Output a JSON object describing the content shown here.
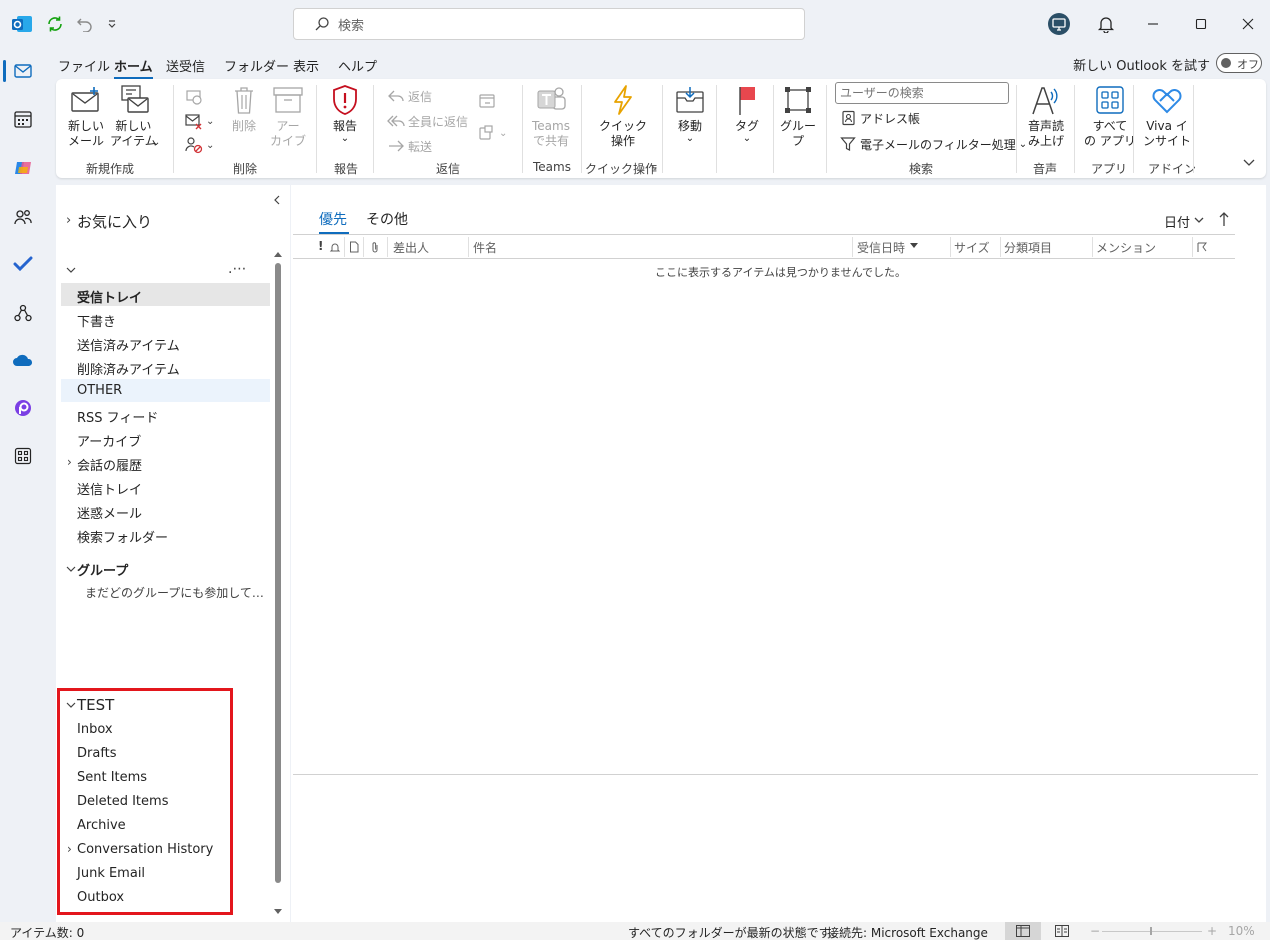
{
  "app": {
    "search_placeholder": "検索"
  },
  "menu": {
    "tabs": [
      "ファイル",
      "ホーム",
      "送受信",
      "フォルダー",
      "表示",
      "ヘルプ"
    ],
    "active_tab": "ホーム",
    "new_outlook_label": "新しい Outlook を試す",
    "toggle_label": "オフ"
  },
  "ribbon": {
    "new_mail": "新しい\nメール",
    "new_item": "新しい\nアイテム",
    "group_new": "新規作成",
    "delete_label": "削除",
    "archive_label": "アー\nカイブ",
    "group_delete": "削除",
    "report_label": "報告",
    "group_report": "報告",
    "reply": "返信",
    "reply_all": "全員に返信",
    "forward": "転送",
    "group_reply": "返信",
    "teams_share": "Teams\nで共有",
    "group_teams": "Teams",
    "quick_steps": "クイック\n操作",
    "group_quick": "クイック操作",
    "move_label": "移動",
    "tag_label": "タグ",
    "group_btn": "グルー\nプ",
    "user_search_placeholder": "ユーザーの検索",
    "address_book": "アドレス帳",
    "filter_email": "電子メールのフィルター処理",
    "group_search": "検索",
    "read_aloud": "音声読\nみ上げ",
    "group_voice": "音声",
    "all_apps": "すべて\nの アプリ",
    "group_apps": "アプリ",
    "viva_insights": "Viva イ\nンサイト",
    "group_addin": "アドイン"
  },
  "folders": {
    "favorites": "お気に入り",
    "account_items": [
      {
        "label": "受信トレイ",
        "bold": true,
        "selected": true
      },
      {
        "label": "下書き"
      },
      {
        "label": "送信済みアイテム"
      },
      {
        "label": "削除済みアイテム"
      },
      {
        "label": "OTHER",
        "hover": true
      },
      {
        "label": "RSS フィード"
      },
      {
        "label": "アーカイブ"
      },
      {
        "label": "会話の履歴",
        "expandable": true
      },
      {
        "label": "送信トレイ"
      },
      {
        "label": "迷惑メール"
      },
      {
        "label": "検索フォルダー"
      }
    ],
    "groups_header": "グループ",
    "groups_empty": "まだどのグループにも参加して…",
    "test_header": "TEST",
    "test_items": [
      {
        "label": "Inbox"
      },
      {
        "label": "Drafts"
      },
      {
        "label": "Sent Items"
      },
      {
        "label": "Deleted Items"
      },
      {
        "label": "Archive"
      },
      {
        "label": "Conversation History",
        "expandable": true
      },
      {
        "label": "Junk Email"
      },
      {
        "label": "Outbox"
      }
    ]
  },
  "messages": {
    "tab_focused": "優先",
    "tab_other": "その他",
    "sort_label": "日付",
    "columns": {
      "from": "差出人",
      "subject": "件名",
      "received": "受信日時",
      "size": "サイズ",
      "category": "分類項目",
      "mention": "メンション"
    },
    "empty_text": "ここに表示するアイテムは見つかりませんでした。"
  },
  "status": {
    "item_count": "アイテム数: 0",
    "folders_status": "すべてのフォルダーが最新の状態です。",
    "connection": "接続先: Microsoft Exchange",
    "zoom": "10%"
  },
  "colors": {
    "accent": "#0f6cbd",
    "highlight_box": "#e3161c"
  }
}
